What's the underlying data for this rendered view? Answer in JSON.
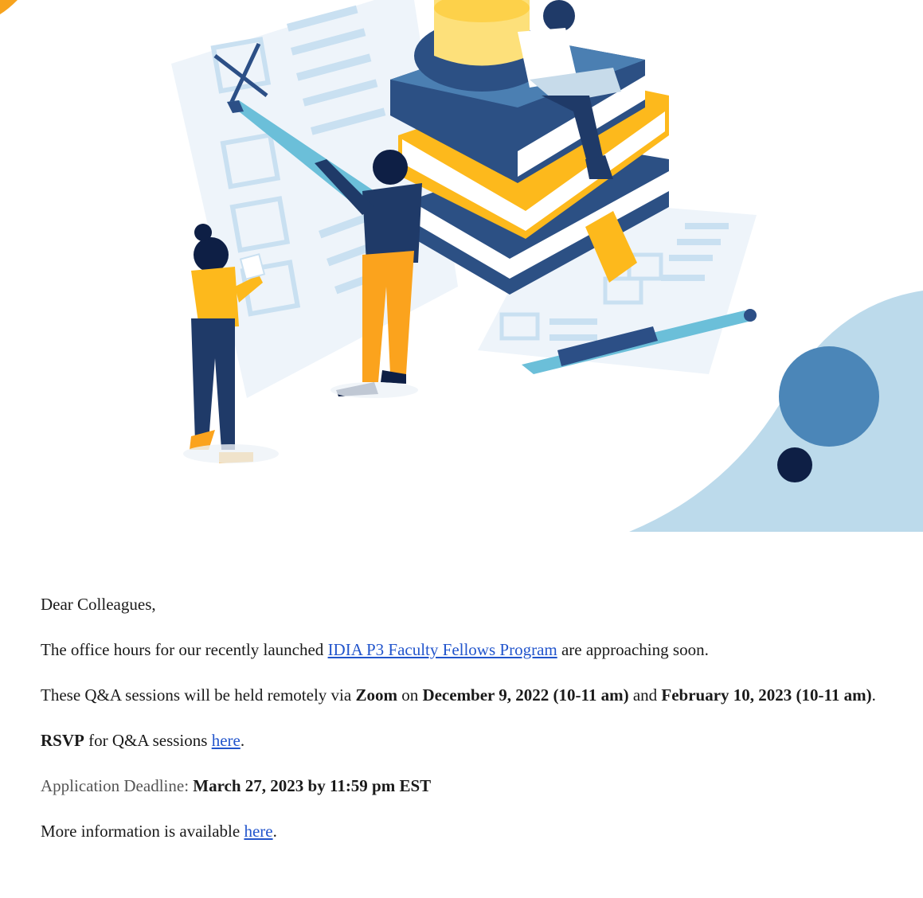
{
  "colors": {
    "accent_link": "#2255cc",
    "navy": "#1f3a68",
    "blue": "#4b86b8",
    "light_blue": "#bcdaeb",
    "yellow": "#fdb91c",
    "orange": "#f7941d"
  },
  "hero": {
    "illustration": "education-illustration-people-books-pencils"
  },
  "email": {
    "greeting": "Dear Colleagues,",
    "p1": {
      "before": "The office hours for our recently launched ",
      "link": "IDIA P3 Faculty Fellows Program",
      "after": " are approaching soon."
    },
    "p2": {
      "t1": "These Q&A sessions will be held remotely via ",
      "b1": "Zoom",
      "t2": " on ",
      "b2": "December 9, 2022 (10-11 am)",
      "t3": " and ",
      "b3": "February 10, 2023 (10-11 am)",
      "t4": "."
    },
    "p3": {
      "b1": "RSVP",
      "t1": " for Q&A sessions ",
      "link": "here",
      "t2": "."
    },
    "p4": {
      "label": "Application Deadline: ",
      "value": "March 27, 2023 by 11:59 pm EST"
    },
    "p5": {
      "t1": "More information is available ",
      "link": "here",
      "t2": "."
    }
  }
}
